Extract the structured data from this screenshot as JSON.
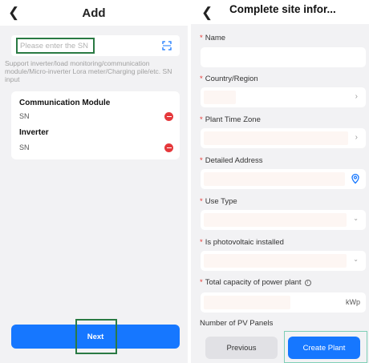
{
  "add_screen": {
    "title": "Add",
    "sn_placeholder": "Please enter the SN",
    "hint": "Support inverter/load monitoring/communication module/Micro-inverter Lora meter/Charging pile/etc. SN input",
    "devices": [
      {
        "type": "Communication Module",
        "sn_label": "SN"
      },
      {
        "type": "Inverter",
        "sn_label": "SN"
      }
    ],
    "next_label": "Next"
  },
  "site_screen": {
    "title": "Complete site infor...",
    "fields": [
      {
        "label": "Name",
        "required": true,
        "icon": "none"
      },
      {
        "label": "Country/Region",
        "required": true,
        "icon": "chevron-right-icon"
      },
      {
        "label": "Plant Time Zone",
        "required": true,
        "icon": "chevron-right-icon"
      },
      {
        "label": "Detailed Address",
        "required": true,
        "icon": "location-pin-icon"
      },
      {
        "label": "Use Type",
        "required": true,
        "icon": "chevron-down-icon"
      },
      {
        "label": "Is photovoltaic installed",
        "required": true,
        "icon": "chevron-down-icon"
      },
      {
        "label": "Total capacity of power plant",
        "required": true,
        "icon": "info-icon",
        "unit": "kWp"
      }
    ],
    "pv_panels_label": "Number of PV Panels",
    "previous_label": "Previous",
    "create_label": "Create Plant",
    "required_mark": "*"
  },
  "colors": {
    "primary": "#1677ff",
    "required": "#e53935",
    "remove": "#e5383b",
    "highlight_frame": "#2a7a43",
    "screen_bg": "#f2f2f4"
  }
}
